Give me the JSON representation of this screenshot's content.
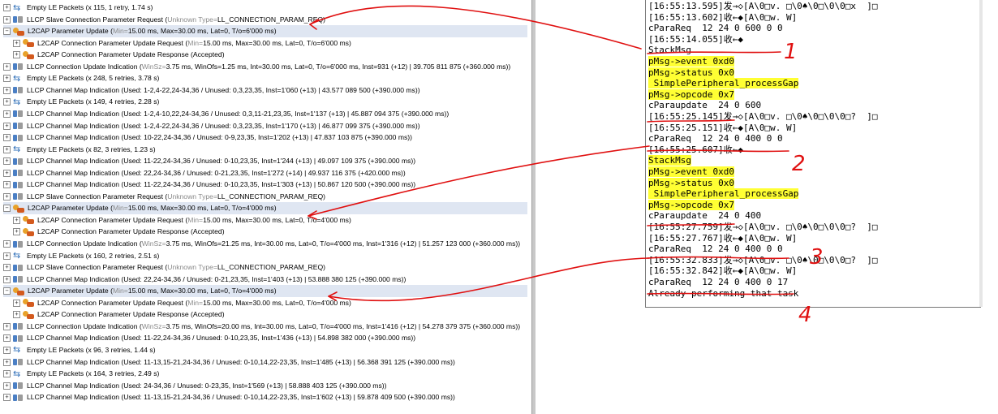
{
  "packet_list": {
    "rows": [
      {
        "exp": "+",
        "icon": "empty-packets-icon",
        "main": "Empty LE Packets (x 115, 1 retry, 1.74 s)",
        "extra": "",
        "sel": false
      },
      {
        "exp": "+",
        "icon": "llcp-icon",
        "main": "LLCP Slave Connection Parameter Request (",
        "gray": "Unknown Type=",
        "main2": "LL_CONNECTION_PARAM_REQ)",
        "sel": false
      },
      {
        "exp": "−",
        "icon": "l2cap-icon",
        "main": "L2CAP Parameter Update (",
        "gray": "Min=",
        "main2": "15.00 ms, Max=30.00 ms, Lat=0, T/o=6'000 ms)",
        "sel": true
      },
      {
        "exp": "+",
        "icon": "l2cap-icon",
        "main": "L2CAP Connection Parameter Update Request (",
        "gray": "Min=",
        "main2": "15.00 ms, Max=30.00 ms, Lat=0, T/o=6'000 ms)",
        "sel": false
      },
      {
        "exp": "+",
        "icon": "l2cap-icon",
        "main": "L2CAP Connection Parameter Update Response (Accepted)",
        "sel": false
      },
      {
        "exp": "+",
        "icon": "llcp-icon",
        "main": "LLCP Connection Update Indication (",
        "gray": "WinSz=",
        "main2": "3.75 ms, WinOfs=1.25 ms, Int=30.00 ms, Lat=0, T/o=6'000 ms, Inst=931 (+12) | 39.705 811 875 (+360.000 ms))",
        "sel": false
      },
      {
        "exp": "+",
        "icon": "empty-packets-icon",
        "main": "Empty LE Packets (x 248, 5 retries, 3.78 s)",
        "sel": false
      },
      {
        "exp": "+",
        "icon": "llcp-icon",
        "main": "LLCP Channel Map Indication (Used: 1-2,4-22,24-34,36 / Unused: 0,3,23,35, Inst=1'060 (+13) | 43.577 089 500 (+390.000 ms))",
        "sel": false
      },
      {
        "exp": "+",
        "icon": "empty-packets-icon",
        "main": "Empty LE Packets (x 149, 4 retries, 2.28 s)",
        "sel": false
      },
      {
        "exp": "+",
        "icon": "llcp-icon",
        "main": "LLCP Channel Map Indication (Used: 1-2,4-10,22,24-34,36 / Unused: 0,3,11-21,23,35, Inst=1'137 (+13) | 45.887 094 375 (+390.000 ms))",
        "sel": false
      },
      {
        "exp": "+",
        "icon": "llcp-icon",
        "main": "LLCP Channel Map Indication (Used: 1-2,4-22,24-34,36 / Unused: 0,3,23,35, Inst=1'170 (+13) | 46.877 099 375 (+390.000 ms))",
        "sel": false
      },
      {
        "exp": "+",
        "icon": "llcp-icon",
        "main": "LLCP Channel Map Indication (Used: 10-22,24-34,36 / Unused: 0-9,23,35, Inst=1'202 (+13) | 47.837 103 875 (+390.000 ms))",
        "sel": false
      },
      {
        "exp": "+",
        "icon": "empty-packets-icon",
        "main": "Empty LE Packets (x 82, 3 retries, 1.23 s)",
        "sel": false
      },
      {
        "exp": "+",
        "icon": "llcp-icon",
        "main": "LLCP Channel Map Indication (Used: 11-22,24-34,36 / Unused: 0-10,23,35, Inst=1'244 (+13) | 49.097 109 375 (+390.000 ms))",
        "sel": false
      },
      {
        "exp": "+",
        "icon": "llcp-icon",
        "main": "LLCP Channel Map Indication (Used: 22,24-34,36 / Unused: 0-21,23,35, Inst=1'272 (+14) | 49.937 116 375 (+420.000 ms))",
        "sel": false
      },
      {
        "exp": "+",
        "icon": "llcp-icon",
        "main": "LLCP Channel Map Indication (Used: 11-22,24-34,36 / Unused: 0-10,23,35, Inst=1'303 (+13) | 50.867 120 500 (+390.000 ms))",
        "sel": false
      },
      {
        "exp": "+",
        "icon": "llcp-icon",
        "main": "LLCP Slave Connection Parameter Request (",
        "gray": "Unknown Type=",
        "main2": "LL_CONNECTION_PARAM_REQ)",
        "sel": false
      },
      {
        "exp": "−",
        "icon": "l2cap-icon",
        "main": "L2CAP Parameter Update (",
        "gray": "Min=",
        "main2": "15.00 ms, Max=30.00 ms, Lat=0, T/o=4'000 ms)",
        "sel": true
      },
      {
        "exp": "+",
        "icon": "l2cap-icon",
        "main": "L2CAP Connection Parameter Update Request (",
        "gray": "Min=",
        "main2": "15.00 ms, Max=30.00 ms, Lat=0, T/o=4'000 ms)",
        "sel": false
      },
      {
        "exp": "+",
        "icon": "l2cap-icon",
        "main": "L2CAP Connection Parameter Update Response (Accepted)",
        "sel": false
      },
      {
        "exp": "+",
        "icon": "llcp-icon",
        "main": "LLCP Connection Update Indication (",
        "gray": "WinSz=",
        "main2": "3.75 ms, WinOfs=21.25 ms, Int=30.00 ms, Lat=0, T/o=4'000 ms, Inst=1'316 (+12) | 51.257 123 000 (+360.000 ms))",
        "sel": false
      },
      {
        "exp": "+",
        "icon": "empty-packets-icon",
        "main": "Empty LE Packets (x 160, 2 retries, 2.51 s)",
        "sel": false
      },
      {
        "exp": "+",
        "icon": "llcp-icon",
        "main": "LLCP Slave Connection Parameter Request (",
        "gray": "Unknown Type=",
        "main2": "LL_CONNECTION_PARAM_REQ)",
        "sel": false
      },
      {
        "exp": "+",
        "icon": "llcp-icon",
        "main": "LLCP Channel Map Indication (Used: 22,24-34,36 / Unused: 0-21,23,35, Inst=1'403 (+13) | 53.888 380 125 (+390.000 ms))",
        "sel": false
      },
      {
        "exp": "−",
        "icon": "l2cap-icon",
        "main": "L2CAP Parameter Update (",
        "gray": "Min=",
        "main2": "15.00 ms, Max=30.00 ms, Lat=0, T/o=4'000 ms)",
        "sel": true
      },
      {
        "exp": "+",
        "icon": "l2cap-icon",
        "main": "L2CAP Connection Parameter Update Request (",
        "gray": "Min=",
        "main2": "15.00 ms, Max=30.00 ms, Lat=0, T/o=4'000 ms)",
        "sel": false
      },
      {
        "exp": "+",
        "icon": "l2cap-icon",
        "main": "L2CAP Connection Parameter Update Response (Accepted)",
        "sel": false
      },
      {
        "exp": "+",
        "icon": "llcp-icon",
        "main": "LLCP Connection Update Indication (",
        "gray": "WinSz=",
        "main2": "3.75 ms, WinOfs=20.00 ms, Int=30.00 ms, Lat=0, T/o=4'000 ms, Inst=1'416 (+12) | 54.278 379 375 (+360.000 ms))",
        "sel": false
      },
      {
        "exp": "+",
        "icon": "llcp-icon",
        "main": "LLCP Channel Map Indication (Used: 11-22,24-34,36 / Unused: 0-10,23,35, Inst=1'436 (+13) | 54.898 382 000 (+390.000 ms))",
        "sel": false
      },
      {
        "exp": "+",
        "icon": "empty-packets-icon",
        "main": "Empty LE Packets (x 96, 3 retries, 1.44 s)",
        "sel": false
      },
      {
        "exp": "+",
        "icon": "llcp-icon",
        "main": "LLCP Channel Map Indication (Used: 11-13,15-21,24-34,36 / Unused: 0-10,14,22-23,35, Inst=1'485 (+13) | 56.368 391 125 (+390.000 ms))",
        "sel": false
      },
      {
        "exp": "+",
        "icon": "empty-packets-icon",
        "main": "Empty LE Packets (x 164, 3 retries, 2.49 s)",
        "sel": false
      },
      {
        "exp": "+",
        "icon": "llcp-icon",
        "main": "LLCP Channel Map Indication (Used: 24-34,36 / Unused: 0-23,35, Inst=1'569 (+13) | 58.888 403 125 (+390.000 ms))",
        "sel": false
      },
      {
        "exp": "+",
        "icon": "llcp-icon",
        "main": "LLCP Channel Map Indication (Used: 11-13,15-21,24-34,36 / Unused: 0-10,14,22-23,35, Inst=1'602 (+13) | 59.878 409 500 (+390.000 ms))",
        "sel": false
      }
    ]
  },
  "console": {
    "lines": [
      {
        "text": "[16:55:13.595]发→◇[A\\0□v. □\\0♠\\0□\\0\\0□x  ]□",
        "hl": false
      },
      {
        "text": "[16:55:13.602]收←◆[A\\0□w. W]",
        "hl": false
      },
      {
        "text": "cParaReq  12 24 0 600 0 0",
        "hl": false
      },
      {
        "text": "[16:55:14.055]收←◆",
        "hl": false
      },
      {
        "text": "StackMsg",
        "hl": false
      },
      {
        "text": "pMsg->event 0xd0",
        "hl": true
      },
      {
        "text": "pMsg->status 0x0",
        "hl": true
      },
      {
        "text": " SimplePeripheral_processGap",
        "hl": true
      },
      {
        "text": "pMsg->opcode 0x7",
        "hl": true
      },
      {
        "text": "cParaupdate  24 0 600",
        "hl": false
      },
      {
        "text": "[16:55:25.145]发→◇[A\\0□v. □\\0♠\\0□\\0\\0□?  ]□",
        "hl": false
      },
      {
        "text": "[16:55:25.151]收←◆[A\\0□w. W]",
        "hl": false
      },
      {
        "text": "cParaReq  12 24 0 400 0 0",
        "hl": false
      },
      {
        "text": "[16:55:25.607]收←◆",
        "hl": false
      },
      {
        "text": "StackMsg",
        "hl": true
      },
      {
        "text": "pMsg->event 0xd0",
        "hl": true
      },
      {
        "text": "pMsg->status 0x0",
        "hl": true
      },
      {
        "text": " SimplePeripheral_processGap",
        "hl": true
      },
      {
        "text": "pMsg->opcode 0x7",
        "hl": true
      },
      {
        "text": "cParaupdate  24 0 400",
        "hl": false
      },
      {
        "text": "[16:55:27.759]发→◇[A\\0□v. □\\0♠\\0□\\0\\0□?  ]□",
        "hl": false
      },
      {
        "text": "[16:55:27.767]收←◆[A\\0□w. W]",
        "hl": false
      },
      {
        "text": "cParaReq  12 24 0 400 0 0",
        "hl": false
      },
      {
        "text": "[16:55:32.833]发→◇[A\\0□v. □\\0♠\\0□\\0\\0□?  ]□",
        "hl": false
      },
      {
        "text": "[16:55:32.842]收←◆[A\\0□w. W]",
        "hl": false
      },
      {
        "text": "cParaReq  12 24 0 400 0 17",
        "hl": false
      },
      {
        "text": "Already performing that task",
        "hl": false
      }
    ]
  },
  "annotations": {
    "numbers": [
      "1",
      "2",
      "3",
      "4"
    ],
    "color": "#e01010"
  },
  "colors": {
    "highlight": "#ffff33",
    "selected_row": "#dfe6f2",
    "annotation_red": "#e01010"
  }
}
